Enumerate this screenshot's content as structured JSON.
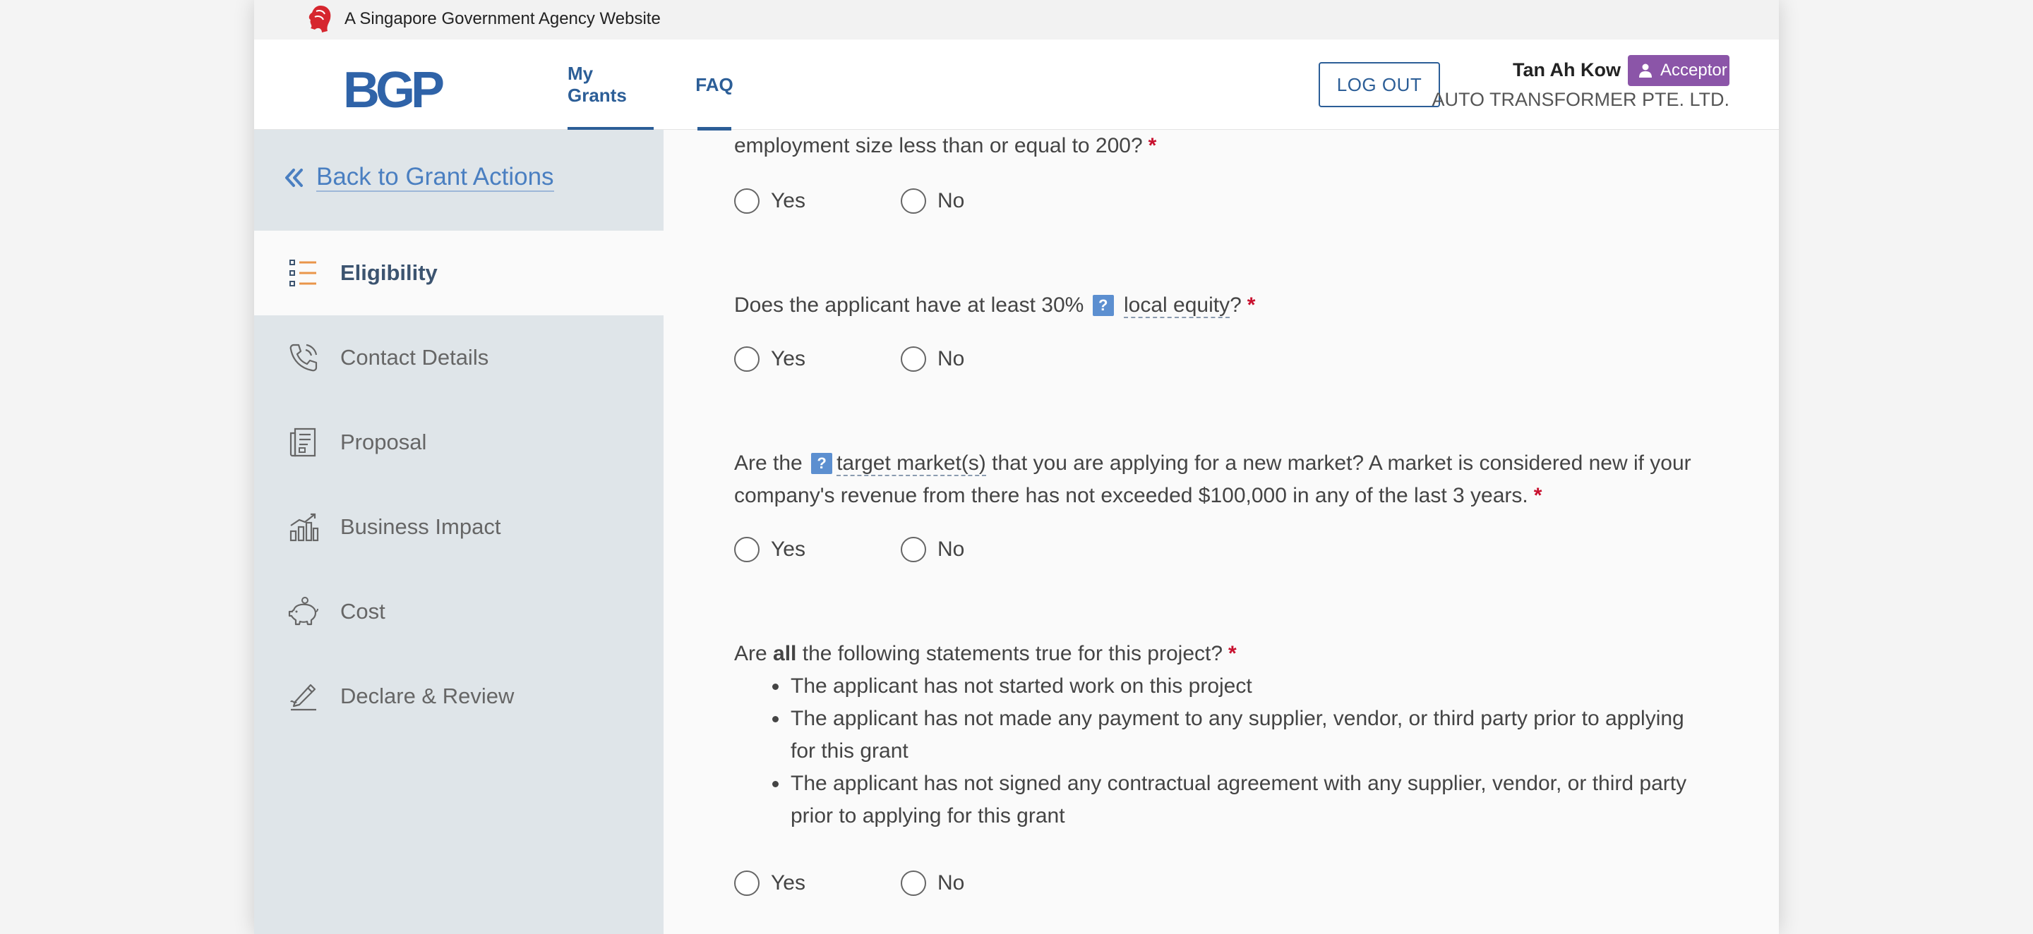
{
  "masthead": {
    "text": "A Singapore Government Agency Website"
  },
  "header": {
    "logo": "BGP",
    "nav": [
      {
        "label": "My Grants",
        "active": true
      },
      {
        "label": "FAQ",
        "active": true
      }
    ],
    "logout_label": "LOG OUT",
    "user_name": "Tan Ah Kow",
    "role": "Acceptor",
    "company": "AUTO TRANSFORMER PTE. LTD."
  },
  "sidebar": {
    "back_label": "Back to Grant Actions",
    "items": [
      {
        "label": "Eligibility",
        "icon": "checklist-icon",
        "active": true
      },
      {
        "label": "Contact Details",
        "icon": "phone-icon",
        "active": false
      },
      {
        "label": "Proposal",
        "icon": "document-icon",
        "active": false
      },
      {
        "label": "Business Impact",
        "icon": "bar-chart-icon",
        "active": false
      },
      {
        "label": "Cost",
        "icon": "piggy-bank-icon",
        "active": false
      },
      {
        "label": "Declare & Review",
        "icon": "signature-icon",
        "active": false
      }
    ]
  },
  "questions": {
    "q1": {
      "text": "employment size less than or equal to 200?",
      "required": "*"
    },
    "q2": {
      "prefix": "Does the applicant have at least 30%",
      "term": "local equity",
      "suffix": "?",
      "required": "*"
    },
    "q3": {
      "prefix": "Are the",
      "term": "target market(s)",
      "line1_suffix": "that you are applying for a new market? A market is considered new if your",
      "line2": "company's revenue from there has not exceeded $100,000 in any of the last 3 years.",
      "required": "*"
    },
    "q4": {
      "prefix": "Are",
      "emphasis": "all",
      "suffix": "the following statements true for this project?",
      "required": "*",
      "statements": [
        "The applicant has not started work on this project",
        "The applicant has not made any payment to any supplier, vendor, or third party prior to applying",
        "for this grant",
        "The applicant has not signed any contractual agreement with any supplier, vendor, or third party",
        "prior to applying for this grant"
      ]
    },
    "options": {
      "yes": "Yes",
      "no": "No"
    },
    "help_glyph": "?"
  },
  "colors": {
    "brand_blue": "#2c5e97",
    "logo_blue": "#2f63a8",
    "role_badge": "#8b55a8",
    "required": "#c8102e",
    "sidebar_bg": "#dfe5e9",
    "icon_orange": "#e9954a"
  }
}
